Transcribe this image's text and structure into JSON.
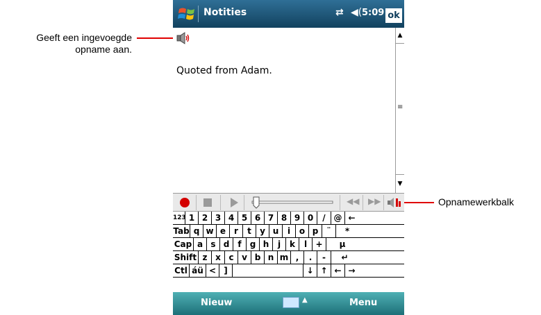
{
  "callouts": {
    "left_line1": "Geeft een ingevoegde",
    "left_line2": "opname aan.",
    "right": "Opnamewerkbalk",
    "line_color": "#e00000"
  },
  "titlebar": {
    "title": "Notities",
    "clock": "5:09",
    "ok_label": "ok",
    "connectivity_icon": "⇄",
    "volume_icon": "◀("
  },
  "note": {
    "text": "Quoted from Adam."
  },
  "recording_toolbar": {
    "record_icon": "record-icon",
    "stop_icon": "stop-icon",
    "play_icon": "play-icon",
    "prev_label": "◀◀",
    "next_label": "▶▶"
  },
  "keyboard": {
    "rows": [
      [
        "123",
        "1",
        "2",
        "3",
        "4",
        "5",
        "6",
        "7",
        "8",
        "9",
        "0",
        "/",
        "@",
        "←"
      ],
      [
        "Tab",
        "q",
        "w",
        "e",
        "r",
        "t",
        "y",
        "u",
        "i",
        "o",
        "p",
        "¨",
        "*"
      ],
      [
        "Cap",
        "a",
        "s",
        "d",
        "f",
        "g",
        "h",
        "j",
        "k",
        "l",
        "+",
        "µ"
      ],
      [
        "Shift",
        "z",
        "x",
        "c",
        "v",
        "b",
        "n",
        "m",
        ",",
        ".",
        "-",
        "↵"
      ],
      [
        "Ctl",
        "áü",
        "<",
        "]",
        "",
        "↓",
        "↑",
        "←",
        "→"
      ]
    ]
  },
  "softkeys": {
    "left": "Nieuw",
    "right": "Menu",
    "caret": "▲"
  }
}
